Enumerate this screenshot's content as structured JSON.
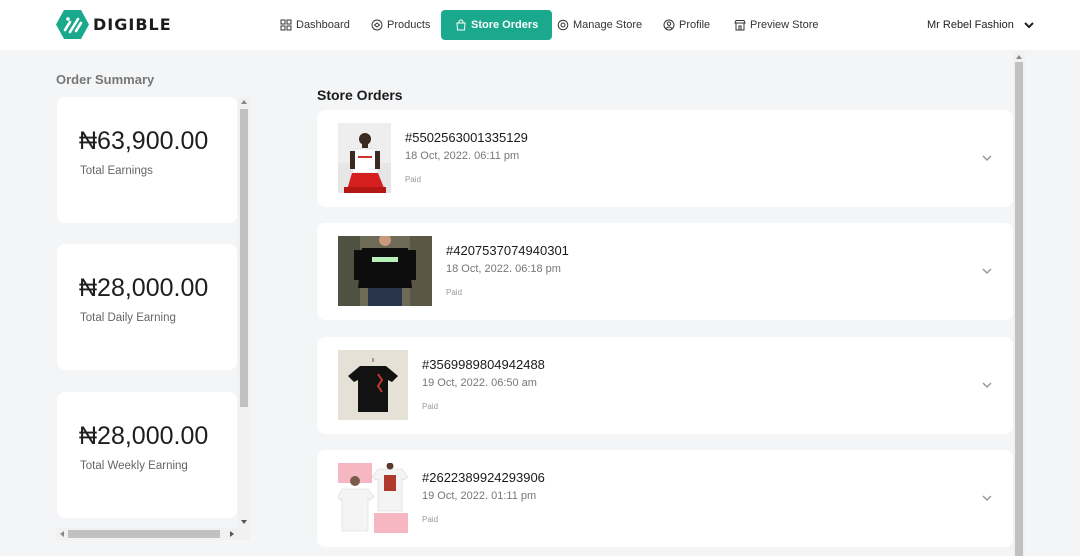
{
  "brand": {
    "name": "DIGIBLE",
    "accent": "#1aa98c"
  },
  "nav": [
    {
      "label": "Dashboard",
      "icon": "dashboard-icon",
      "active": false
    },
    {
      "label": "Products",
      "icon": "products-icon",
      "active": false
    },
    {
      "label": "Store Orders",
      "icon": "store-orders-icon",
      "active": true
    },
    {
      "label": "Manage Store",
      "icon": "manage-store-icon",
      "active": false
    },
    {
      "label": "Profile",
      "icon": "profile-icon",
      "active": false
    },
    {
      "label": "Preview Store",
      "icon": "preview-store-icon",
      "active": false
    }
  ],
  "account": {
    "name": "Mr Rebel Fashion",
    "icon": "chevron-down-icon"
  },
  "summary": {
    "title": "Order Summary",
    "cards": [
      {
        "amount": "₦63,900.00",
        "label": "Total Earnings"
      },
      {
        "amount": "₦28,000.00",
        "label": "Total Daily Earning"
      },
      {
        "amount": "₦28,000.00",
        "label": "Total Weekly Earning"
      }
    ]
  },
  "orders": {
    "title": "Store Orders",
    "items": [
      {
        "id": "#5502563001335129",
        "date": "18 Oct, 2022. 06:11 pm",
        "status": "Paid",
        "image": "man-in-white-tshirt-photo"
      },
      {
        "id": "#4207537074940301",
        "date": "18 Oct, 2022. 06:18 pm",
        "status": "Paid",
        "image": "person-in-black-tshirt-photo"
      },
      {
        "id": "#3569989804942488",
        "date": "19 Oct, 2022. 06:50 am",
        "status": "Paid",
        "image": "black-tshirt-on-hanger-photo"
      },
      {
        "id": "#2622389924293906",
        "date": "19 Oct, 2022. 01:11 pm",
        "status": "Paid",
        "image": "white-tshirts-collage-photo"
      }
    ]
  }
}
